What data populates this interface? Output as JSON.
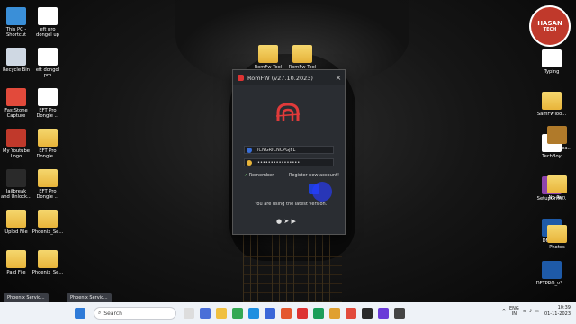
{
  "desktop": {
    "left_col1": [
      {
        "label": "This PC -\nShortcut",
        "icon": "this-pc-icon",
        "color": "#3a8fd8"
      },
      {
        "label": "Recycle Bin",
        "icon": "recycle-bin-icon",
        "color": "#cfd8e3"
      },
      {
        "label": "FastStone\nCapture",
        "icon": "faststone-icon",
        "color": "#e24a3b"
      },
      {
        "label": "My Youtube\nLogo",
        "icon": "youtube-logo-icon",
        "color": "#c0392b"
      },
      {
        "label": "Jailbreak\nand Unlock...",
        "icon": "jailbreak-icon",
        "color": "#2a2a2a"
      },
      {
        "label": "Uplod File",
        "icon": "folder-icon",
        "color": "#e8b43a"
      },
      {
        "label": "Paid File",
        "icon": "folder-icon",
        "color": "#e8b43a"
      }
    ],
    "left_col2": [
      {
        "label": "eft pro\ndongol up",
        "icon": "document-icon",
        "color": "#ffffff"
      },
      {
        "label": "eft dongol\npro",
        "icon": "document-icon",
        "color": "#ffffff"
      },
      {
        "label": "EFT Pro\nDongle ...",
        "icon": "media-icon",
        "color": "#ffffff"
      },
      {
        "label": "EFT Pro\nDongle ...",
        "icon": "folder-icon",
        "color": "#e8b43a"
      },
      {
        "label": "EFT Pro\nDongle ...",
        "icon": "folder-icon",
        "color": "#e8b43a"
      },
      {
        "label": "Phoenix_Se...",
        "icon": "folder-icon",
        "color": "#e8b43a"
      },
      {
        "label": "Phoenix_Se...",
        "icon": "folder-icon",
        "color": "#e8b43a"
      }
    ],
    "top_mid": [
      {
        "label": "RomFw Tool",
        "icon": "folder-icon",
        "color": "#e8b43a"
      },
      {
        "label": "RomFw Tool",
        "icon": "folder-icon",
        "color": "#e8b43a"
      }
    ],
    "right_col": [
      {
        "label": "Typing",
        "icon": "document-icon",
        "color": "#ffffff"
      },
      {
        "label": "SamFwToo...",
        "icon": "folder-icon",
        "color": "#e8b43a"
      },
      {
        "label": "TechBoy",
        "icon": "document-icon",
        "color": "#ffffff"
      },
      {
        "label": "SetupGriffi...",
        "icon": "winrar-icon",
        "color": "#8e44ad"
      },
      {
        "label": "DFTPRO",
        "icon": "dftpro-icon",
        "color": "#1e5aa8"
      },
      {
        "label": "DFTPRO_v3...",
        "icon": "dftpro-icon",
        "color": "#1e5aa8"
      }
    ],
    "right_col2": [
      {
        "label": "TFMMedea...",
        "icon": "tfm-icon",
        "color": "#b07a2a"
      },
      {
        "label": "No Run",
        "icon": "folder-icon",
        "color": "#e8b43a"
      },
      {
        "label": "Photos",
        "icon": "folder-icon",
        "color": "#e8b43a"
      }
    ],
    "brand_logo": {
      "line1": "HASAN",
      "line2": "TECH"
    }
  },
  "window": {
    "title": "RomFW (v27.10.2023)",
    "close": "×",
    "username": "ICNGRICNCPGJFL",
    "password": "••••••••••••••••",
    "remember_label": "Remember",
    "register_label": "Register new account!",
    "status": "You are using the latest version.",
    "accent": "#e03a3a"
  },
  "task_windows": [
    {
      "label": "Phoenix Servic..."
    },
    {
      "label": "Phoenix Servic..."
    }
  ],
  "taskbar": {
    "search_placeholder": "Search",
    "lang_line1": "ENG",
    "lang_line2": "IN",
    "time": "10:39",
    "date": "01-11-2023"
  }
}
